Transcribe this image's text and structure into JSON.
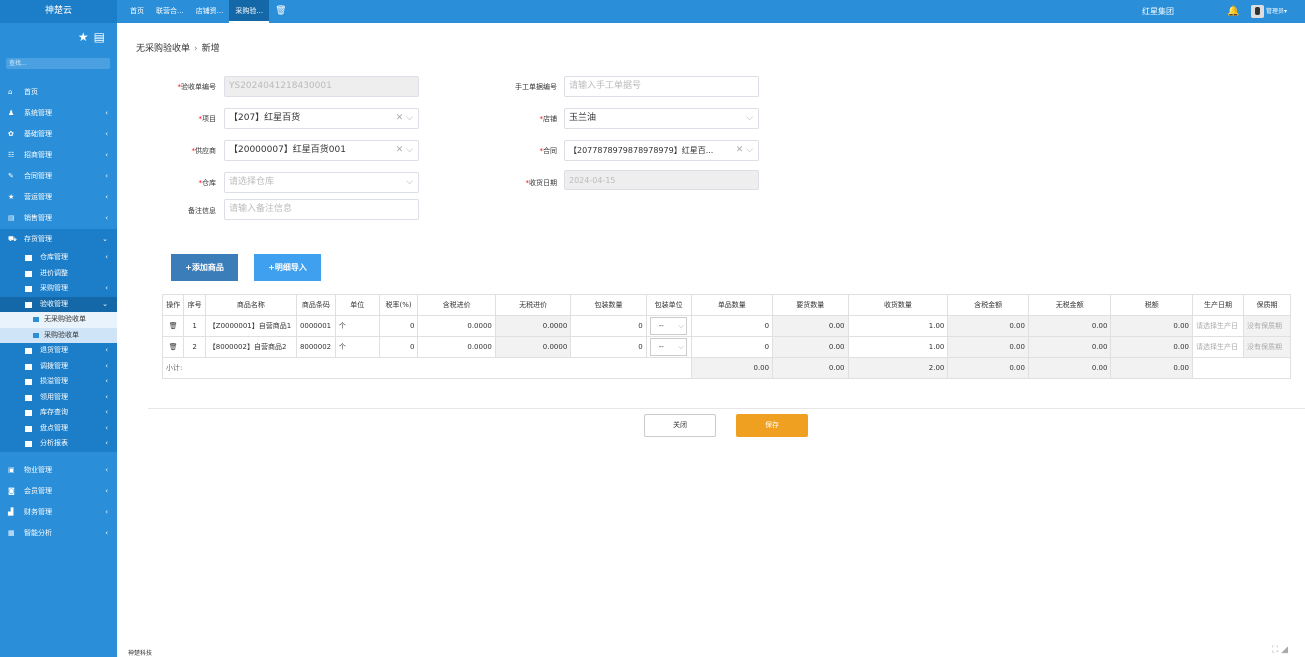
{
  "brand": "神楚云",
  "tabs": [
    "首页",
    "联营合...",
    "店铺资...",
    "采购验..."
  ],
  "company": "红星集团",
  "admin": "管理员",
  "sidebar": {
    "search": "查找...",
    "menu": [
      {
        "icon": "⌂",
        "label": "首页"
      },
      {
        "icon": "♟",
        "label": "系统管理"
      },
      {
        "icon": "✿",
        "label": "基础管理"
      },
      {
        "icon": "☷",
        "label": "招商管理"
      },
      {
        "icon": "✎",
        "label": "合同管理"
      },
      {
        "icon": "★",
        "label": "营运管理"
      },
      {
        "icon": "▤",
        "label": "销售管理"
      }
    ],
    "open": {
      "icon": "⛟",
      "label": "存货管理"
    },
    "subs_before": [
      "仓库管理",
      "进价调整",
      "采购管理"
    ],
    "sub_open": "验收管理",
    "subsubs": [
      "无采购验收单",
      "采购验收单"
    ],
    "subs_after": [
      "退货管理",
      "调拨管理",
      "损溢管理",
      "领用管理",
      "库存查询",
      "盘点管理",
      "分析报表"
    ],
    "menu_after": [
      {
        "icon": "▣",
        "label": "物业管理"
      },
      {
        "icon": "◙",
        "label": "会员管理"
      },
      {
        "icon": "▟",
        "label": "财务管理"
      },
      {
        "icon": "▦",
        "label": "智能分析"
      }
    ]
  },
  "breadcrumb": {
    "parent": "无采购验收单",
    "current": "新增"
  },
  "form": {
    "receipt_no_label": "验收单编号",
    "receipt_no": "YS2024041218430001",
    "manual_no_label": "手工单据编号",
    "manual_no_placeholder": "请输入手工单据号",
    "project_label": "项目",
    "project": "【207】红星百货",
    "store_label": "店铺",
    "store": "玉兰油",
    "supplier_label": "供应商",
    "supplier": "【20000007】红星百货001",
    "contract_label": "合同",
    "contract": "【2077878979878978979】红星百...",
    "warehouse_label": "仓库",
    "warehouse_placeholder": "请选择仓库",
    "date_label": "收货日期",
    "date": "2024-04-15",
    "note_label": "备注信息",
    "note_placeholder": "请输入备注信息"
  },
  "buttons": {
    "add_goods": "+添加商品",
    "import": "+明细导入",
    "close": "关闭",
    "save": "保存"
  },
  "table": {
    "headers": [
      "操作",
      "序号",
      "商品名称",
      "商品条码",
      "单位",
      "税率(%)",
      "含税进价",
      "无税进价",
      "包装数量",
      "包装单位",
      "单品数量",
      "要货数量",
      "收货数量",
      "含税金额",
      "无税金额",
      "税额",
      "生产日期",
      "保质期"
    ],
    "rows": [
      {
        "no": "1",
        "name": "【Z0000001】自营商品1",
        "code": "0000001",
        "unit": "个",
        "tax": "0",
        "price_tax": "0.0000",
        "price_notax": "0.0000",
        "pack_qty": "0",
        "pack_unit": "--",
        "item_qty": "0",
        "req_qty": "0.00",
        "recv_qty": "1.00",
        "amt_tax": "0.00",
        "amt_notax": "0.00",
        "tax_amt": "0.00",
        "prod_date": "请选择生产日",
        "shelf": "没有保质期"
      },
      {
        "no": "2",
        "name": "【8000002】自营商品2",
        "code": "8000002",
        "unit": "个",
        "tax": "0",
        "price_tax": "0.0000",
        "price_notax": "0.0000",
        "pack_qty": "0",
        "pack_unit": "--",
        "item_qty": "0",
        "req_qty": "0.00",
        "recv_qty": "1.00",
        "amt_tax": "0.00",
        "amt_notax": "0.00",
        "tax_amt": "0.00",
        "prod_date": "请选择生产日",
        "shelf": "没有保质期"
      }
    ],
    "subtotal_label": "小计:",
    "subtotal": {
      "item_qty": "0.00",
      "req_qty": "0.00",
      "recv_qty": "2.00",
      "amt_tax": "0.00",
      "amt_notax": "0.00",
      "tax_amt": "0.00"
    }
  },
  "footer": "神楚科技",
  "colors": {
    "primary": "#2a8fd8",
    "button_blue": "#3b8ed0",
    "button_light": "#3fa0f0",
    "save": "#f0a020"
  }
}
